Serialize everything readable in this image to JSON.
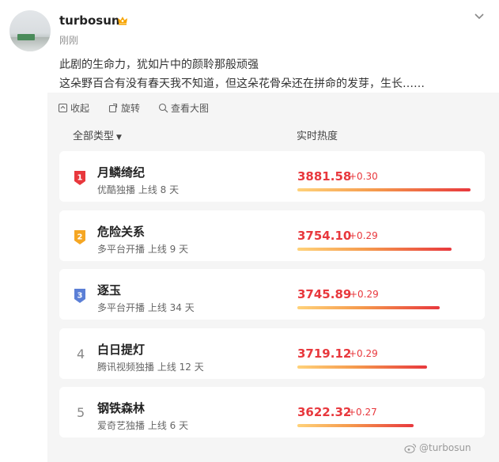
{
  "post": {
    "username": "turbosun",
    "timestamp": "刚刚",
    "text_line1": "此剧的生命力，犹如片中的颜聆那般顽强",
    "text_line2": "这朵野百合有没有春天我不知道，但这朵花骨朵还在拼命的发芽，生长……"
  },
  "card_actions": {
    "collect_label": "收起",
    "rotate_label": "旋转",
    "view_label": "查看大图"
  },
  "ranking": {
    "category_label": "全部类型",
    "heat_label": "实时热度",
    "items": [
      {
        "rank": "1",
        "title": "月鳞绮纪",
        "sub": "优酷独播 上线 8 天",
        "score": "3881.58",
        "delta": "+0.30",
        "heat_fraction": 1.0
      },
      {
        "rank": "2",
        "title": "危险关系",
        "sub": "多平台开播 上线 9 天",
        "score": "3754.10",
        "delta": "+0.29",
        "heat_fraction": 0.89
      },
      {
        "rank": "3",
        "title": "逐玉",
        "sub": "多平台开播 上线 34 天",
        "score": "3745.89",
        "delta": "+0.29",
        "heat_fraction": 0.82
      },
      {
        "rank": "4",
        "title": "白日提灯",
        "sub": "腾讯视频独播 上线 12 天",
        "score": "3719.12",
        "delta": "+0.29",
        "heat_fraction": 0.75
      },
      {
        "rank": "5",
        "title": "钢铁森林",
        "sub": "爱奇艺独播 上线 6 天",
        "score": "3622.32",
        "delta": "+0.27",
        "heat_fraction": 0.67
      }
    ]
  },
  "watermark": "@turbosun",
  "colors": {
    "accent_red": "#e8383d",
    "badge_1": "#e8383d",
    "badge_2": "#f5a623",
    "badge_3": "#5b7fd6"
  }
}
